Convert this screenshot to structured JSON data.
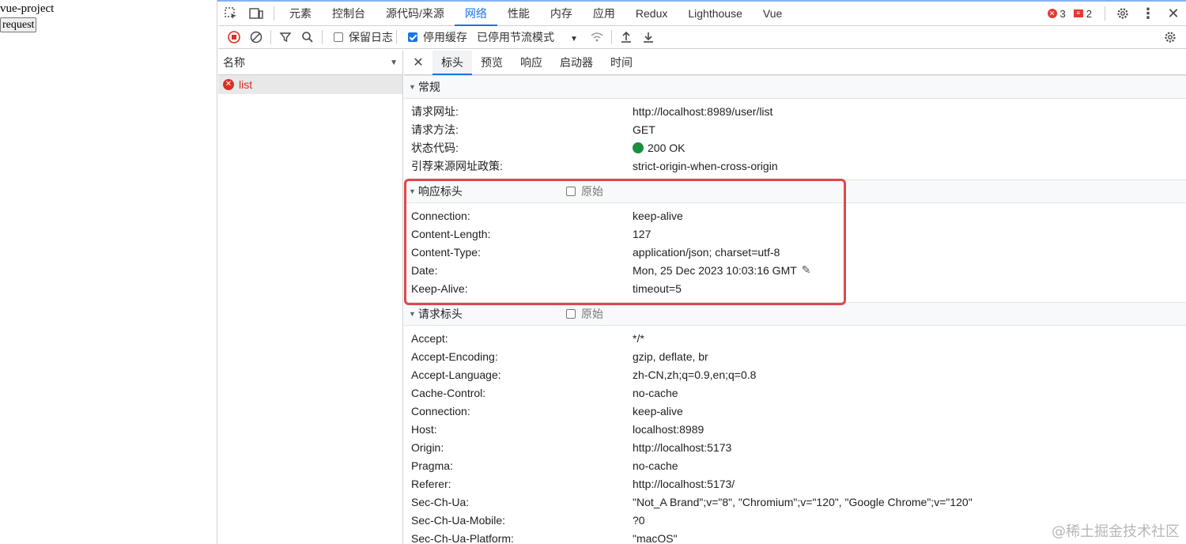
{
  "page": {
    "title": "vue-project",
    "button_label": "request"
  },
  "devtools": {
    "tabs": [
      "元素",
      "控制台",
      "源代码/来源",
      "网络",
      "性能",
      "内存",
      "应用",
      "Redux",
      "Lighthouse",
      "Vue"
    ],
    "active_tab": "网络",
    "errors_count": "3",
    "issues_count": "2",
    "toolbar": {
      "preserve_log": "保留日志",
      "disable_cache": "停用缓存",
      "throttle": "已停用节流模式"
    },
    "names_header": "名称",
    "requests": [
      {
        "name": "list",
        "status": "error"
      }
    ],
    "detail_tabs": [
      "标头",
      "预览",
      "响应",
      "启动器",
      "时间"
    ],
    "active_detail_tab": "标头",
    "general": {
      "title": "常规",
      "rows": [
        {
          "k": "请求网址:",
          "v": "http://localhost:8989/user/list"
        },
        {
          "k": "请求方法:",
          "v": "GET"
        },
        {
          "k": "状态代码:",
          "v": "200 OK"
        },
        {
          "k": "引荐来源网址政策:",
          "v": "strict-origin-when-cross-origin"
        }
      ]
    },
    "response_headers": {
      "title": "响应标头",
      "raw_label": "原始",
      "rows": [
        {
          "k": "Connection:",
          "v": "keep-alive"
        },
        {
          "k": "Content-Length:",
          "v": "127"
        },
        {
          "k": "Content-Type:",
          "v": "application/json; charset=utf-8"
        },
        {
          "k": "Date:",
          "v": "Mon, 25 Dec 2023 10:03:16 GMT"
        },
        {
          "k": "Keep-Alive:",
          "v": "timeout=5"
        }
      ]
    },
    "request_headers": {
      "title": "请求标头",
      "raw_label": "原始",
      "rows": [
        {
          "k": "Accept:",
          "v": "*/*"
        },
        {
          "k": "Accept-Encoding:",
          "v": "gzip, deflate, br"
        },
        {
          "k": "Accept-Language:",
          "v": "zh-CN,zh;q=0.9,en;q=0.8"
        },
        {
          "k": "Cache-Control:",
          "v": "no-cache"
        },
        {
          "k": "Connection:",
          "v": "keep-alive"
        },
        {
          "k": "Host:",
          "v": "localhost:8989"
        },
        {
          "k": "Origin:",
          "v": "http://localhost:5173"
        },
        {
          "k": "Pragma:",
          "v": "no-cache"
        },
        {
          "k": "Referer:",
          "v": "http://localhost:5173/"
        },
        {
          "k": "Sec-Ch-Ua:",
          "v": "\"Not_A Brand\";v=\"8\", \"Chromium\";v=\"120\", \"Google Chrome\";v=\"120\""
        },
        {
          "k": "Sec-Ch-Ua-Mobile:",
          "v": "?0"
        },
        {
          "k": "Sec-Ch-Ua-Platform:",
          "v": "\"macOS\""
        }
      ]
    }
  },
  "watermark": "@稀土掘金技术社区",
  "colors": {
    "accent": "#1a73e8",
    "error": "#d93025",
    "ok": "#1e8e3e",
    "highlight": "#e0474c"
  }
}
